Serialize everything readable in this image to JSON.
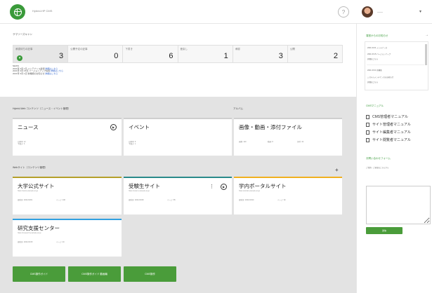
{
  "header": {
    "site_name": "Hybrid-HP CMS",
    "help_label": "?",
    "user_name": "——",
    "caret": "▾"
  },
  "summary": {
    "title": "サマリーズキャン",
    "stats": [
      {
        "label": "承認待ちの記事",
        "value": "3"
      },
      {
        "label": "公開予定の記事",
        "value": "0"
      },
      {
        "label": "下書き",
        "value": "6"
      },
      {
        "label": "差戻し",
        "value": "1"
      },
      {
        "label": "承認",
        "value": "3"
      },
      {
        "label": "公開",
        "value": "2"
      }
    ],
    "arrow_icon": "▾"
  },
  "notices": {
    "heading": "NEWS",
    "lines": [
      {
        "text": "2021年 4月 1日 メンテナンス情報",
        "link": "詳細はこちら"
      },
      {
        "text": "2021年 3月 15日 バージョンアップ情報",
        "link": "詳細はこちら"
      },
      {
        "text": "2021年 3月 1日 新機能のお知らせ",
        "link": "詳細はこちら"
      }
    ]
  },
  "groups": {
    "news_events": "Hybrid-Web コンテンツ（ニュース・イベント管理）",
    "album": "アルバム",
    "web_sites": "Webサイト（コンテンツ管理）"
  },
  "cards": {
    "news": {
      "title": "ニュース",
      "meta1": "公開中: 12",
      "meta2": "下書き: 3"
    },
    "event": {
      "title": "イベント",
      "meta1": "公開中: 5",
      "meta2": "下書き: 1"
    },
    "media": {
      "title": "画像・動画・添付ファイル",
      "meta1": "画像: 120",
      "meta2": "動画: 8",
      "meta3": "添付: 34"
    },
    "univ": {
      "title": "大学公式サイト",
      "sub": "https://www.example.ac.jp",
      "meta1": "更新日: 2021/04/01",
      "meta2": "ページ: 240"
    },
    "exam": {
      "title": "受験生サイト",
      "sub": "https://exam.example.ac.jp",
      "meta1": "更新日: 2021/03/28",
      "meta2": "ページ: 85"
    },
    "portal": {
      "title": "学内ポータルサイト",
      "sub": "https://portal.example.ac.jp",
      "meta1": "更新日: 2021/03/20",
      "meta2": "ページ: 62"
    },
    "research": {
      "title": "研究支援センター",
      "sub": "https://research.example.ac.jp",
      "meta1": "更新日: 2021/03/15",
      "meta2": "ページ: 40"
    }
  },
  "icons": {
    "play": "▶",
    "kebab": "⋮",
    "plus": "+"
  },
  "buttons": [
    {
      "label": "CMS操作ガイド"
    },
    {
      "label": "CMS操作ガイド 動画編"
    },
    {
      "label": "CMS操作"
    }
  ],
  "sidebar": {
    "info_title": "運営からのお知らせ",
    "info_arrow": "→",
    "info_lines": [
      "2021.04.01 メンテナンス",
      "2021.03.15 バージョンアップ",
      "詳細はこちら",
      "2021.03.01 新機能",
      "システムメンテナンスのお知らせ",
      "詳細はこちら"
    ],
    "manual_title": "CMSマニュアル",
    "manuals": [
      "CMS管理者マニュアル",
      "サイト管理者マニュアル",
      "サイト編集者マニュアル",
      "サイト閲覧者マニュアル"
    ],
    "inquiry_title": "お問い合わせフォーム",
    "inquiry_note": "ご質問・ご要望はこちらから",
    "inquiry_placeholder": "",
    "send_label": "送信"
  }
}
